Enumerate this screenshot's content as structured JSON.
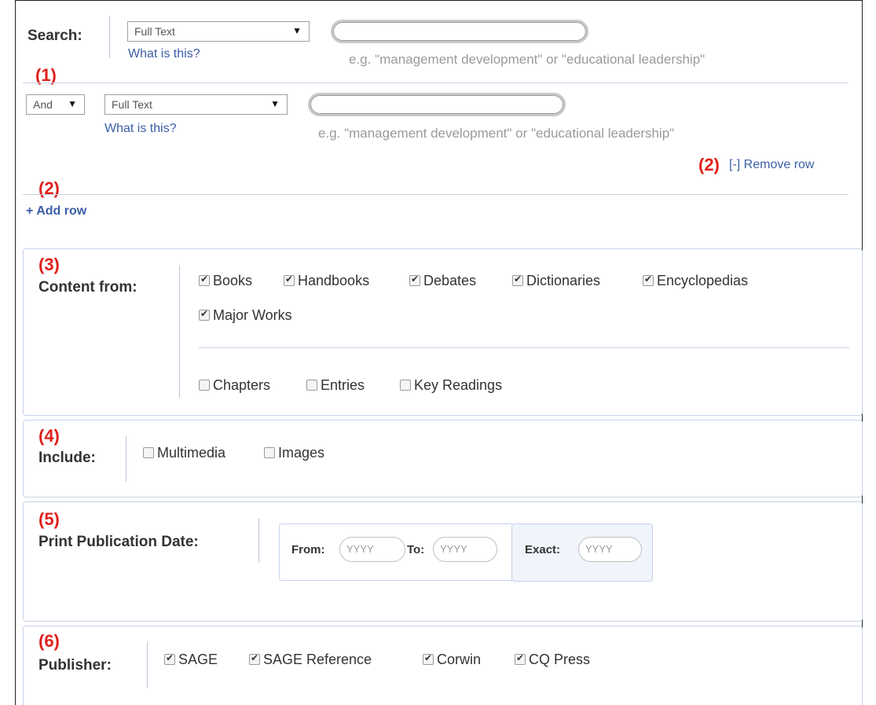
{
  "search_row1": {
    "label": "Search:",
    "field_select": "Full Text",
    "what_link": "What is this?",
    "hint": "e.g. \"management development\" or \"educational leadership\""
  },
  "search_row2": {
    "bool_select": "And",
    "field_select": "Full Text",
    "what_link": "What is this?",
    "hint": "e.g. \"management development\" or \"educational leadership\"",
    "remove_link": "[-] Remove row"
  },
  "add_row": "+ Add row",
  "annotations": [
    "(1)",
    "(2)",
    "(2)",
    "(3)",
    "(4)",
    "(5)",
    "(6)"
  ],
  "content_from": {
    "label": "Content from:",
    "sources": [
      {
        "label": "Books",
        "checked": true
      },
      {
        "label": "Handbooks",
        "checked": true
      },
      {
        "label": "Debates",
        "checked": true
      },
      {
        "label": "Dictionaries",
        "checked": true
      },
      {
        "label": "Encyclopedias",
        "checked": true
      },
      {
        "label": "Major Works",
        "checked": true
      }
    ],
    "types": [
      {
        "label": "Chapters",
        "checked": false
      },
      {
        "label": "Entries",
        "checked": false
      },
      {
        "label": "Key Readings",
        "checked": false
      }
    ]
  },
  "include": {
    "label": "Include:",
    "options": [
      {
        "label": "Multimedia",
        "checked": false
      },
      {
        "label": "Images",
        "checked": false
      }
    ]
  },
  "pub_date": {
    "label": "Print Publication Date:",
    "from_label": "From:",
    "to_label": "To:",
    "exact_label": "Exact:",
    "placeholder": "YYYY"
  },
  "publisher": {
    "label": "Publisher:",
    "options": [
      {
        "label": "SAGE",
        "checked": true
      },
      {
        "label": "SAGE Reference",
        "checked": true
      },
      {
        "label": "Corwin",
        "checked": true
      },
      {
        "label": "CQ Press",
        "checked": true
      }
    ]
  },
  "colors": {
    "accent_red": "#e0201b",
    "link_blue": "#3b5ea8",
    "panel_border": "#c6d3e8",
    "exact_bg": "#f0f4fb"
  }
}
